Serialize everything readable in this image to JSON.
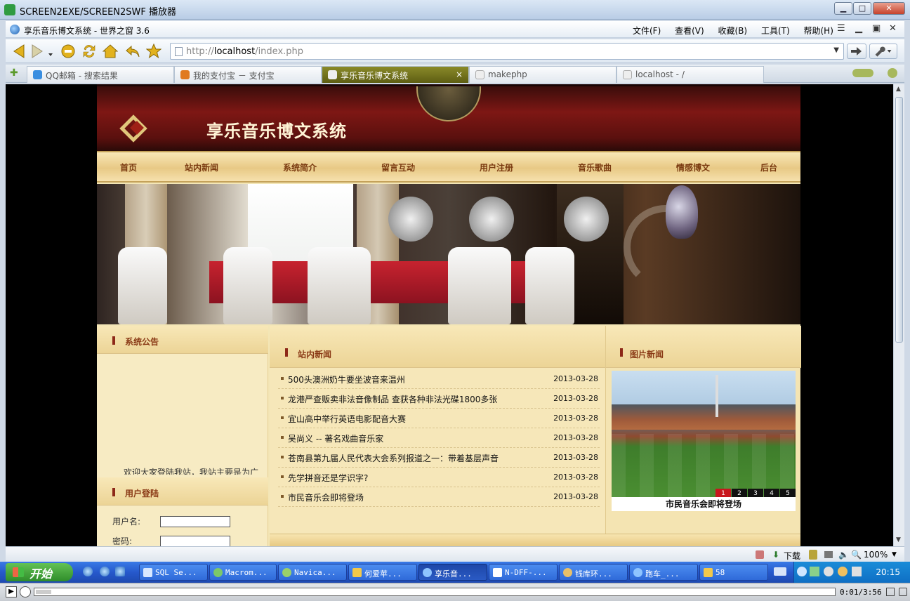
{
  "window": {
    "title": "SCREEN2EXE/SCREEN2SWF 播放器",
    "min": "▁",
    "max": "□",
    "close": "✕"
  },
  "browser": {
    "title": "享乐音乐博文系统 - 世界之窗 3.6",
    "menus": [
      "文件(F)",
      "查看(V)",
      "收藏(B)",
      "工具(T)",
      "帮助(H)"
    ],
    "address_prefix": "http://",
    "address_host": "localhost",
    "address_path": "/index.php",
    "tabs": [
      {
        "label": "QQ邮箱 - 搜索结果",
        "icon_color": "#3a8ee0"
      },
      {
        "label": "我的支付宝 － 支付宝",
        "icon_color": "#e07a20"
      },
      {
        "label": "享乐音乐博文系统",
        "icon_color": "#dddddd"
      },
      {
        "label": "makephp",
        "icon_color": "#dddddd"
      },
      {
        "label": "localhost - /",
        "icon_color": "#dddddd"
      }
    ],
    "tab_close": "×",
    "add_tab": "✚"
  },
  "site": {
    "title": "享乐音乐博文系统",
    "nav": [
      "首页",
      "站内新闻",
      "系统简介",
      "留言互动",
      "用户注册",
      "音乐歌曲",
      "情感博文",
      "后台"
    ],
    "notice_title": "系统公告",
    "notice_text": "欢迎大家登陆我站，我站主要是为广",
    "login_title": "用户登陆",
    "username_label": "用户名:",
    "password_label": "密码:",
    "news_title": "站内新闻",
    "news": [
      {
        "title": "500头澳洲奶牛要坐波音来温州",
        "date": "2013-03-28"
      },
      {
        "title": "龙港严查贩卖非法音像制品 查获各种非法光碟1800多张",
        "date": "2013-03-28"
      },
      {
        "title": "宜山高中举行英语电影配音大赛",
        "date": "2013-03-28"
      },
      {
        "title": "吴尚义 -- 著名戏曲音乐家",
        "date": "2013-03-28"
      },
      {
        "title": "苍南县第九届人民代表大会系列报道之一：带着基层声音",
        "date": "2013-03-28"
      },
      {
        "title": "先学拼音还是学识字?",
        "date": "2013-03-28"
      },
      {
        "title": "市民音乐会即将登场",
        "date": "2013-03-28"
      }
    ],
    "pic_title": "图片新闻",
    "pic_pages": [
      "1",
      "2",
      "3",
      "4",
      "5"
    ],
    "pic_caption": "市民音乐会即将登场"
  },
  "status": {
    "download": "下载",
    "zoom": "100%"
  },
  "taskbar": {
    "start": "开始",
    "tasks": [
      "SQL Se...",
      "Macrom...",
      "Navica...",
      "何爱苹...",
      "享乐音...",
      "N-DFF-...",
      "钱库环...",
      "跑车_...",
      "58"
    ],
    "clock": "20:15"
  },
  "player": {
    "play": "▶",
    "time": "0:01/3:56"
  }
}
